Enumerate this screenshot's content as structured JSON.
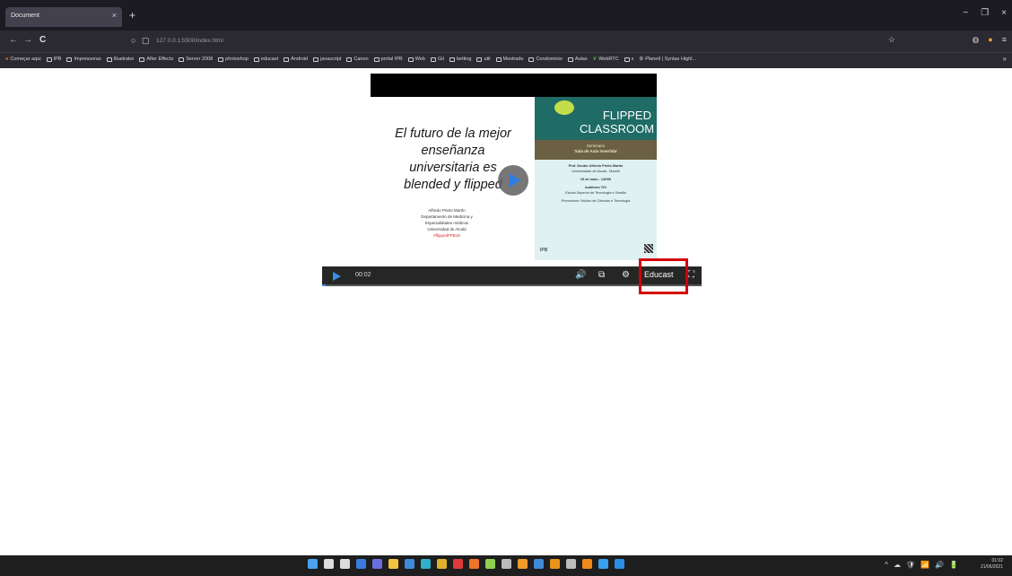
{
  "browser": {
    "tab_title": "Document",
    "tab_close": "×",
    "new_tab": "+",
    "window_controls": [
      "−",
      "❐",
      "×"
    ],
    "url": "127.0.0.1:5500/index.html",
    "nav": {
      "back": "←",
      "forward": "→",
      "reload": "C"
    },
    "bookmarks": [
      {
        "label": "Começar aqui",
        "icon": "firefox-icon"
      },
      {
        "label": "IPB",
        "icon": "folder-icon"
      },
      {
        "label": "Impressoras",
        "icon": "folder-icon"
      },
      {
        "label": "Illustrator",
        "icon": "folder-icon"
      },
      {
        "label": "After Effects",
        "icon": "folder-icon"
      },
      {
        "label": "Server 2008",
        "icon": "folder-icon"
      },
      {
        "label": "photoshop",
        "icon": "folder-icon"
      },
      {
        "label": "educast",
        "icon": "folder-icon"
      },
      {
        "label": "Android",
        "icon": "folder-icon"
      },
      {
        "label": "javascript",
        "icon": "folder-icon"
      },
      {
        "label": "Canon",
        "icon": "folder-icon"
      },
      {
        "label": "portal IPB",
        "icon": "folder-icon"
      },
      {
        "label": "Web",
        "icon": "folder-icon"
      },
      {
        "label": "Git",
        "icon": "folder-icon"
      },
      {
        "label": "betting",
        "icon": "folder-icon"
      },
      {
        "label": "util",
        "icon": "folder-icon"
      },
      {
        "label": "Mestrado",
        "icon": "folder-icon"
      },
      {
        "label": "Condominio",
        "icon": "folder-icon"
      },
      {
        "label": "Aulas",
        "icon": "folder-icon"
      },
      {
        "label": "WebRTC",
        "icon": "leaf-icon"
      },
      {
        "label": "x",
        "icon": "folder-icon"
      },
      {
        "label": "Planetl | Syntax Highl...",
        "icon": "gear-icon"
      }
    ],
    "bookmarks_more": "»"
  },
  "slide": {
    "title_lines": [
      "El futuro de la mejor",
      "enseñanza",
      "universitaria es",
      "blended y flipped"
    ],
    "author_lines": [
      "Alfredo Prieto Martín",
      "Departamento de Medicina y",
      "Especialidades médicas",
      "Universidad de Alcalá"
    ],
    "hashtag": "#flippedFPB19"
  },
  "poster": {
    "title_line1": "FLIPPED",
    "title_line2": "CLASSROOM",
    "band_line1": "Seminario",
    "band_line2": "'Sala de Aula Invertida'",
    "speaker": "Prof. Doutor Alfredo Prieto Martín",
    "speaker_affil": "Universidade de Alcalá - Madrid",
    "date": "29 de maio - 14H30",
    "room": "Auditorio TIO",
    "school": "Escola Superior de Tecnologia e Gestão",
    "org": "Promotores: Núcleo de Ciências e Tecnologia",
    "logo": "IPB"
  },
  "player": {
    "time": "00:02",
    "progress_fraction": 0.01,
    "educast_label": "Educast",
    "volume_icon": "🔊",
    "cast_icon": "⧉",
    "settings_icon": "⚙",
    "fullscreen_icon": "⛶"
  },
  "taskbar": {
    "apps": [
      {
        "icon": "windows-start-icon",
        "color": "#4aa3f0"
      },
      {
        "icon": "search-icon",
        "color": "#dddddd"
      },
      {
        "icon": "task-view-icon",
        "color": "#dddddd"
      },
      {
        "icon": "widgets-icon",
        "color": "#3d7ae0"
      },
      {
        "icon": "teams-chat-icon",
        "color": "#6a6ee0"
      },
      {
        "icon": "file-explorer-icon",
        "color": "#f2c33c"
      },
      {
        "icon": "store-icon",
        "color": "#3e8ad6"
      },
      {
        "icon": "edge-icon",
        "color": "#2fb1c8"
      },
      {
        "icon": "chrome-icon",
        "color": "#e0b02c"
      },
      {
        "icon": "app-red-icon",
        "color": "#e03a3a"
      },
      {
        "icon": "firefox-icon",
        "color": "#f0742a"
      },
      {
        "icon": "xbox-icon",
        "color": "#8fd14f"
      },
      {
        "icon": "settings-icon",
        "color": "#bbbbbb"
      },
      {
        "icon": "app-orange-icon",
        "color": "#f09a2a"
      },
      {
        "icon": "mail-icon",
        "color": "#3e8ad6"
      },
      {
        "icon": "illustrator-icon",
        "color": "#e8941a"
      },
      {
        "icon": "notes-icon",
        "color": "#bcbcbc"
      },
      {
        "icon": "vlc-icon",
        "color": "#f08a1a"
      },
      {
        "icon": "photoshop-icon",
        "color": "#3aa0f0"
      },
      {
        "icon": "vscode-icon",
        "color": "#2d8ee6"
      }
    ],
    "tray": [
      "^",
      "☁",
      "🛡",
      "📶",
      "🔊",
      "🔋"
    ],
    "time": "01:02",
    "date": "21/06/2021"
  }
}
